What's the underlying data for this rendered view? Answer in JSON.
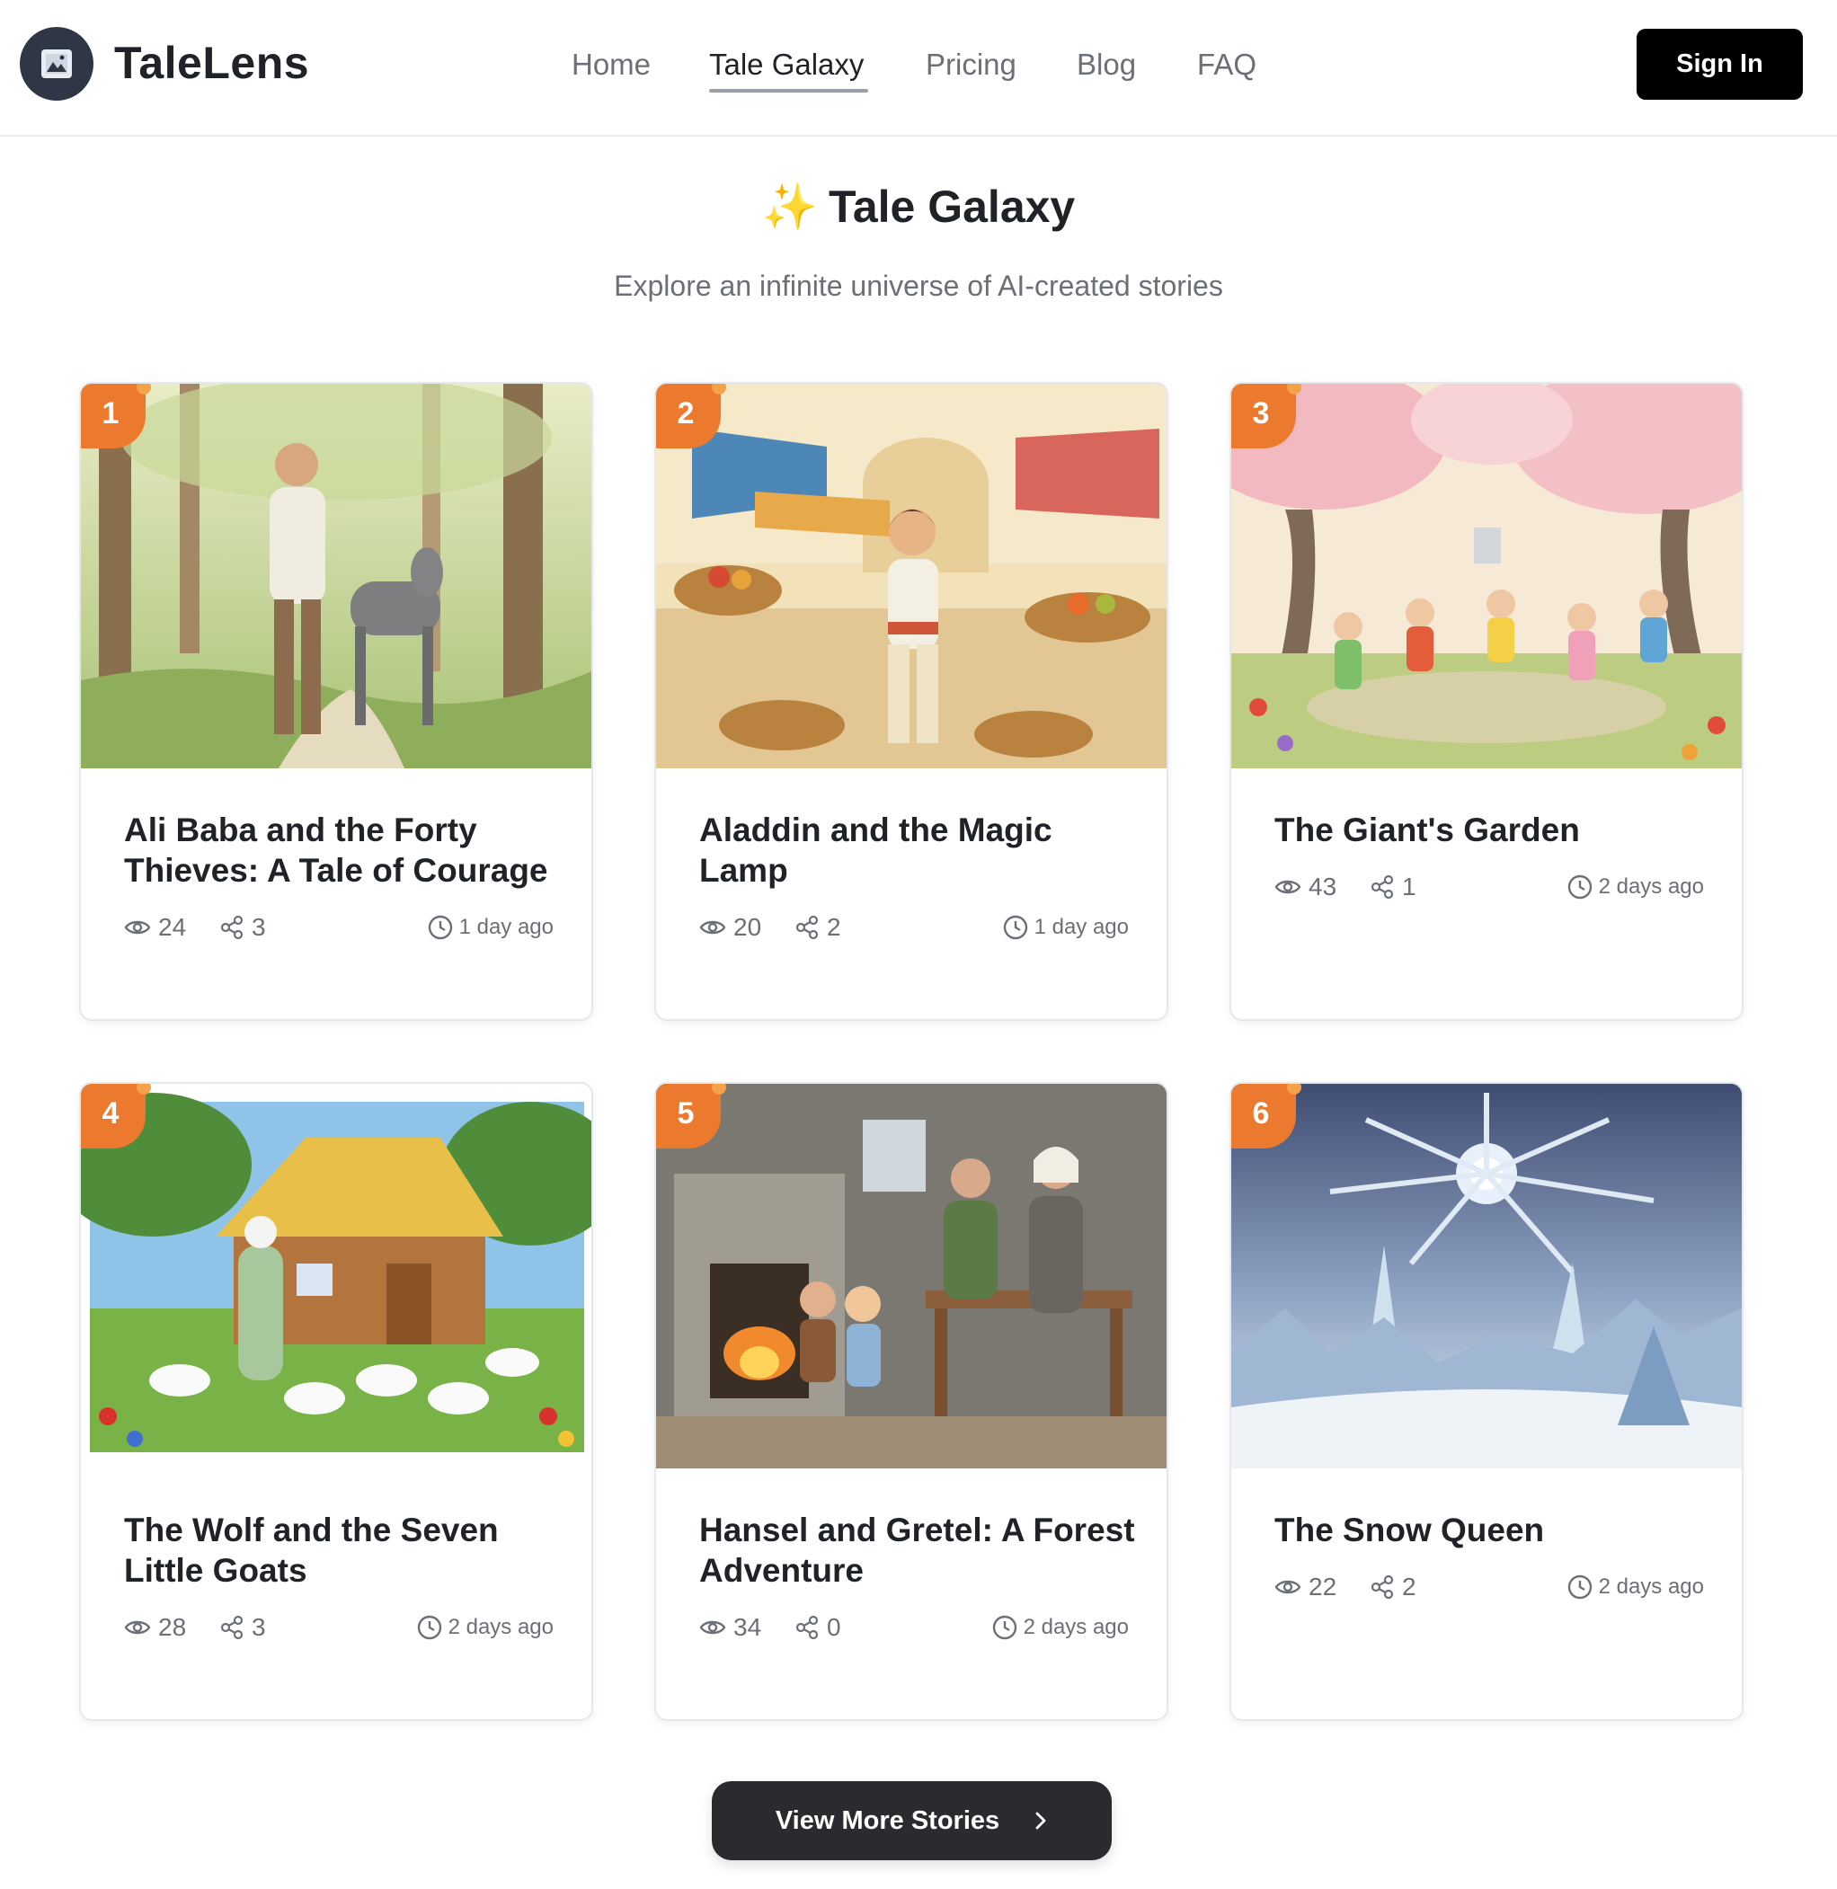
{
  "app": {
    "name": "TaleLens"
  },
  "nav": {
    "items": [
      {
        "label": "Home"
      },
      {
        "label": "Tale Galaxy"
      },
      {
        "label": "Pricing"
      },
      {
        "label": "Blog"
      },
      {
        "label": "FAQ"
      }
    ],
    "active": "Tale Galaxy",
    "signin_label": "Sign In"
  },
  "header": {
    "icon": "sparkles-icon",
    "title": "Tale Galaxy",
    "subtitle": "Explore an infinite universe of AI-created stories"
  },
  "stories": [
    {
      "rank": "1",
      "title": "Ali Baba and the Forty Thieves: A Tale of Courage",
      "views": "24",
      "shares": "3",
      "time": "1 day ago"
    },
    {
      "rank": "2",
      "title": "Aladdin and the Magic Lamp",
      "views": "20",
      "shares": "2",
      "time": "1 day ago"
    },
    {
      "rank": "3",
      "title": "The Giant's Garden",
      "views": "43",
      "shares": "1",
      "time": "2 days ago"
    },
    {
      "rank": "4",
      "title": "The Wolf and the Seven Little Goats",
      "views": "28",
      "shares": "3",
      "time": "2 days ago"
    },
    {
      "rank": "5",
      "title": "Hansel and Gretel: A Forest Adventure",
      "views": "34",
      "shares": "0",
      "time": "2 days ago"
    },
    {
      "rank": "6",
      "title": "The Snow Queen",
      "views": "22",
      "shares": "2",
      "time": "2 days ago"
    }
  ],
  "footer": {
    "more_label": "View More Stories"
  },
  "colors": {
    "rank_badge": "#ec7a2e",
    "primary_button": "#000000",
    "more_button": "#2a2b2e",
    "muted_text": "#6b6f76"
  }
}
